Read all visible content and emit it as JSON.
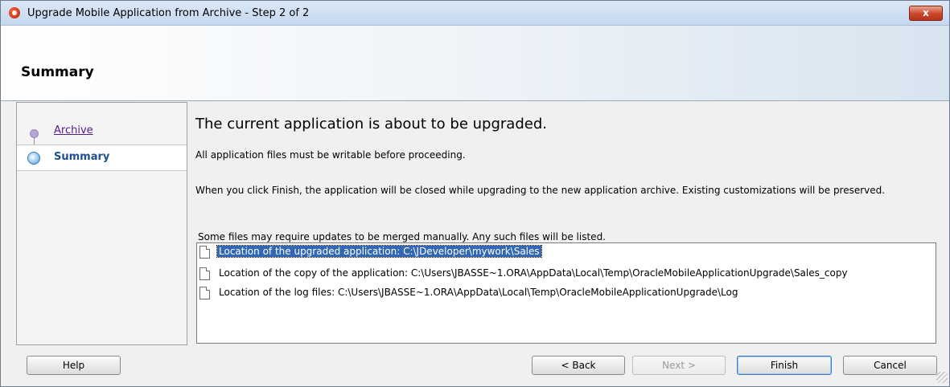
{
  "window": {
    "title": "Upgrade Mobile Application from Archive - Step 2 of 2",
    "close_glyph": "x"
  },
  "header": {
    "title": "Summary"
  },
  "nav": {
    "items": [
      {
        "label": "Archive",
        "state": "visited"
      },
      {
        "label": "Summary",
        "state": "current"
      }
    ]
  },
  "main": {
    "heading": "The current application is about to be upgraded.",
    "para1": "All application files must be writable before proceeding.",
    "para2": "When you click Finish, the application will be closed while upgrading to the new application archive.  Existing customizations will be preserved.",
    "list_caption": "Some files may require updates to be merged manually. Any such files will be listed.",
    "files": [
      "Location of the upgraded application: C:\\JDeveloper\\mywork\\Sales",
      "Location of the copy of the application: C:\\Users\\JBASSE~1.ORA\\AppData\\Local\\Temp\\OracleMobileApplicationUpgrade\\Sales_copy",
      "Location of the log files: C:\\Users\\JBASSE~1.ORA\\AppData\\Local\\Temp\\OracleMobileApplicationUpgrade\\Log"
    ],
    "selected_file_index": 0
  },
  "buttons": {
    "help": "Help",
    "back": "< Back",
    "next": "Next >",
    "finish": "Finish",
    "cancel": "Cancel"
  },
  "colors": {
    "selection": "#3167b4",
    "visited_link": "#551a8b",
    "current_step": "#1f4f8f",
    "close_button": "#c9462a"
  },
  "icons": [
    "app-logo-icon",
    "close-icon",
    "step-dot-icon",
    "current-step-icon",
    "file-icon",
    "resize-grip-icon"
  ]
}
